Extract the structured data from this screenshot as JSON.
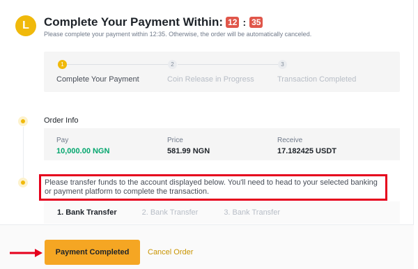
{
  "header": {
    "timer_icon": "L",
    "title": "Complete Your Payment Within:",
    "minutes": "12",
    "seconds": "35",
    "separator": ":",
    "subtitle": "Please complete your payment within 12:35. Otherwise, the order will be automatically canceled."
  },
  "steps": [
    {
      "num": "1",
      "label": "Complete Your Payment",
      "active": true
    },
    {
      "num": "2",
      "label": "Coin Release in Progress",
      "active": false
    },
    {
      "num": "3",
      "label": "Transaction Completed",
      "active": false
    }
  ],
  "order_info": {
    "label": "Order Info",
    "pay_label": "Pay",
    "pay_value": "10,000.00 NGN",
    "price_label": "Price",
    "price_value": "581.99 NGN",
    "receive_label": "Receive",
    "receive_value": "17.182425 USDT"
  },
  "instruction": "Please transfer funds to the account displayed below. You'll need to head to your selected banking or payment platform to complete the transaction.",
  "bank_tabs": [
    {
      "label": "1. Bank Transfer",
      "active": true
    },
    {
      "label": "2. Bank Transfer",
      "active": false
    },
    {
      "label": "3. Bank Transfer",
      "active": false
    }
  ],
  "footer": {
    "primary_label": "Payment Completed",
    "cancel_label": "Cancel Order"
  },
  "colors": {
    "accent": "#f0b90b",
    "highlight": "#e5001c",
    "positive": "#03a66d"
  },
  "icons": {
    "timer": "clock-letter-icon",
    "arrow": "right-arrow-icon"
  }
}
